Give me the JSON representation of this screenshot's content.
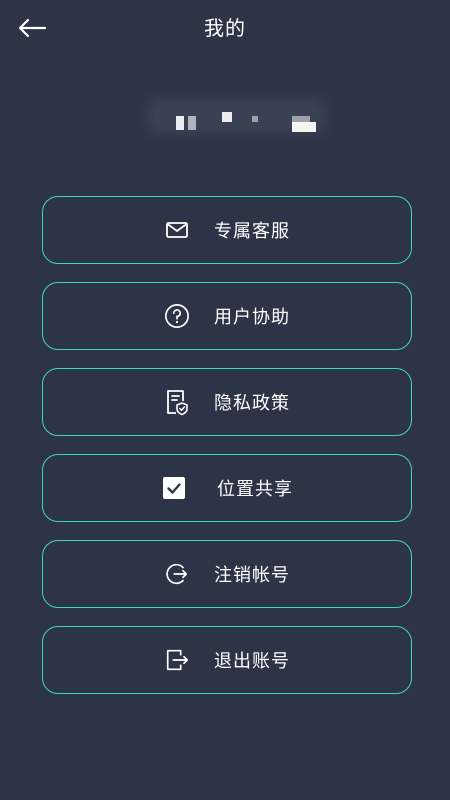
{
  "header": {
    "back_icon": "back-arrow-icon",
    "title": "我的"
  },
  "menu": {
    "items": [
      {
        "label": "专属客服",
        "icon": "mail-icon"
      },
      {
        "label": "用户协助",
        "icon": "help-circle-icon"
      },
      {
        "label": "隐私政策",
        "icon": "policy-document-icon"
      },
      {
        "label": "位置共享",
        "icon": "checkbox-checked-icon"
      },
      {
        "label": "注销帐号",
        "icon": "logout-circle-icon"
      },
      {
        "label": "退出账号",
        "icon": "exit-box-icon"
      }
    ]
  },
  "colors": {
    "background": "#2e3447",
    "accent": "#3fd6c2",
    "text": "#ffffff"
  }
}
